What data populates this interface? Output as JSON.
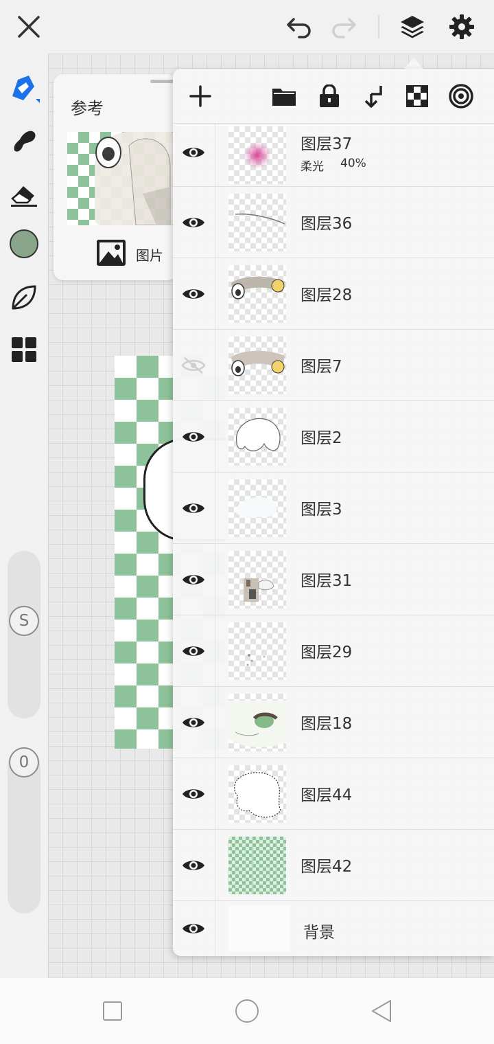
{
  "reference": {
    "title": "参考",
    "image_label": "图片"
  },
  "left_toolbar": {
    "color_swatch": "#8aa68a",
    "slider_size_label": "S",
    "slider_opacity_label": "0"
  },
  "layers": [
    {
      "name": "图层37",
      "mode": "柔光",
      "opacity": "40%",
      "visible": true
    },
    {
      "name": "图层36",
      "visible": true
    },
    {
      "name": "图层28",
      "visible": true
    },
    {
      "name": "图层7",
      "visible": false
    },
    {
      "name": "图层2",
      "visible": true
    },
    {
      "name": "图层3",
      "visible": true
    },
    {
      "name": "图层31",
      "visible": true
    },
    {
      "name": "图层29",
      "visible": true
    },
    {
      "name": "图层18",
      "visible": true
    },
    {
      "name": "图层44",
      "visible": true
    },
    {
      "name": "图层42",
      "visible": true
    },
    {
      "name": "背景",
      "visible": true
    }
  ],
  "colors": {
    "accent": "#1a73e8",
    "checker_green": "#8ec29b"
  }
}
